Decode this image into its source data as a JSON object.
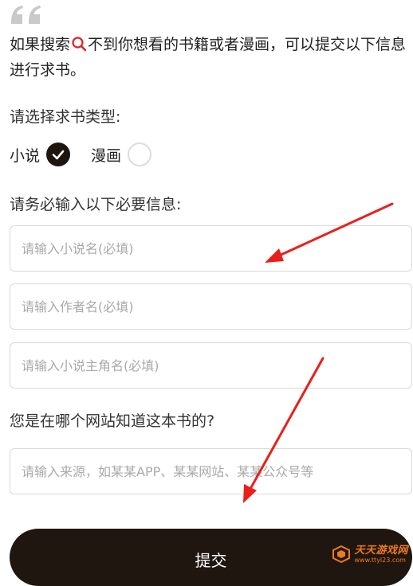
{
  "intro": {
    "part1": "如果搜索",
    "part2": "不到你想看的书籍或者漫画，可以提交以下信息进行求书。"
  },
  "type_section": {
    "label": "请选择求书类型:",
    "options": [
      {
        "label": "小说",
        "selected": true
      },
      {
        "label": "漫画",
        "selected": false
      }
    ]
  },
  "required_section": {
    "label": "请务必输入以下必要信息:"
  },
  "fields": {
    "novel_name_placeholder": "请输入小说名(必填)",
    "author_placeholder": "请输入作者名(必填)",
    "protagonist_placeholder": "请输入小说主角名(必填)"
  },
  "source_section": {
    "label": "您是在哪个网站知道这本书的?",
    "placeholder": "请输入来源，如某某APP、某某网站、某某公众号等"
  },
  "submit": {
    "label": "提交"
  },
  "watermark": {
    "title": "天天游戏网",
    "url": "www.ttyl23.com"
  },
  "colors": {
    "primary_dark": "#1f1610",
    "accent_red": "#e02020",
    "arrow_red": "#e8201c",
    "watermark_orange": "#f07a1a"
  },
  "icons": [
    "quote-icon",
    "search-icon",
    "check-icon",
    "arrow-annotation"
  ]
}
